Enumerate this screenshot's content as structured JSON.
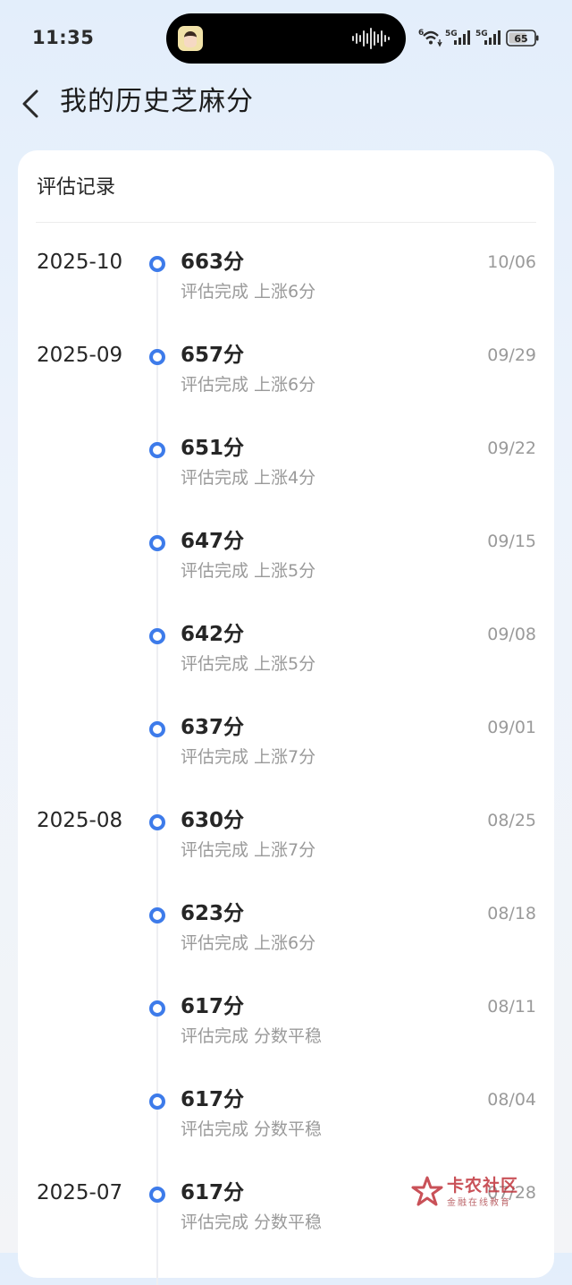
{
  "status_bar": {
    "time": "11:35",
    "battery": "65",
    "network_1": "5G",
    "network_2": "5G",
    "wifi_badge": "6"
  },
  "header": {
    "title": "我的历史芝麻分"
  },
  "card": {
    "title": "评估记录"
  },
  "records": [
    {
      "month": "2025-10",
      "score": "663分",
      "detail": "评估完成 上涨6分",
      "date": "10/06"
    },
    {
      "month": "2025-09",
      "score": "657分",
      "detail": "评估完成 上涨6分",
      "date": "09/29"
    },
    {
      "month": "",
      "score": "651分",
      "detail": "评估完成 上涨4分",
      "date": "09/22"
    },
    {
      "month": "",
      "score": "647分",
      "detail": "评估完成 上涨5分",
      "date": "09/15"
    },
    {
      "month": "",
      "score": "642分",
      "detail": "评估完成 上涨5分",
      "date": "09/08"
    },
    {
      "month": "",
      "score": "637分",
      "detail": "评估完成 上涨7分",
      "date": "09/01"
    },
    {
      "month": "2025-08",
      "score": "630分",
      "detail": "评估完成 上涨7分",
      "date": "08/25"
    },
    {
      "month": "",
      "score": "623分",
      "detail": "评估完成 上涨6分",
      "date": "08/18"
    },
    {
      "month": "",
      "score": "617分",
      "detail": "评估完成 分数平稳",
      "date": "08/11"
    },
    {
      "month": "",
      "score": "617分",
      "detail": "评估完成 分数平稳",
      "date": "08/04"
    },
    {
      "month": "2025-07",
      "score": "617分",
      "detail": "评估完成 分数平稳",
      "date": "07/28"
    }
  ],
  "watermark": {
    "title": "卡农社区",
    "subtitle": "金融在线教育"
  },
  "colors": {
    "accent": "#3d7bea",
    "watermark": "#c0333b"
  },
  "icons": {
    "back": "chevron-left-icon",
    "wifi": "wifi-icon",
    "signal": "signal-icon",
    "battery": "battery-icon",
    "audio": "audio-wave-icon"
  }
}
